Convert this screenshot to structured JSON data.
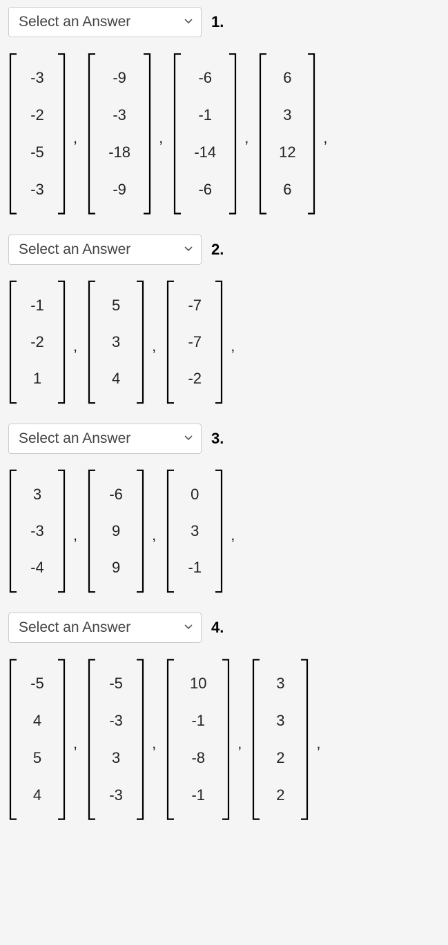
{
  "select_placeholder": "Select an Answer",
  "separator": ",",
  "questions": [
    {
      "label": "1.",
      "size": 4,
      "vectors": [
        {
          "entries": [
            "-3",
            "-2",
            "-5",
            "-3"
          ],
          "wide": false
        },
        {
          "entries": [
            "-9",
            "-3",
            "-18",
            "-9"
          ],
          "wide": true
        },
        {
          "entries": [
            "-6",
            "-1",
            "-14",
            "-6"
          ],
          "wide": true
        },
        {
          "entries": [
            "6",
            "3",
            "12",
            "6"
          ],
          "wide": false
        }
      ],
      "trailing_sep": true
    },
    {
      "label": "2.",
      "size": 3,
      "vectors": [
        {
          "entries": [
            "-1",
            "-2",
            "1"
          ],
          "wide": false
        },
        {
          "entries": [
            "5",
            "3",
            "4"
          ],
          "wide": false
        },
        {
          "entries": [
            "-7",
            "-7",
            "-2"
          ],
          "wide": false
        }
      ],
      "trailing_sep": true
    },
    {
      "label": "3.",
      "size": 3,
      "vectors": [
        {
          "entries": [
            "3",
            "-3",
            "-4"
          ],
          "wide": false
        },
        {
          "entries": [
            "-6",
            "9",
            "9"
          ],
          "wide": false
        },
        {
          "entries": [
            "0",
            "3",
            "-1"
          ],
          "wide": false
        }
      ],
      "trailing_sep": true
    },
    {
      "label": "4.",
      "size": 4,
      "vectors": [
        {
          "entries": [
            "-5",
            "4",
            "5",
            "4"
          ],
          "wide": false
        },
        {
          "entries": [
            "-5",
            "-3",
            "3",
            "-3"
          ],
          "wide": false
        },
        {
          "entries": [
            "10",
            "-1",
            "-8",
            "-1"
          ],
          "wide": true
        },
        {
          "entries": [
            "3",
            "3",
            "2",
            "2"
          ],
          "wide": false
        }
      ],
      "trailing_sep": true
    }
  ]
}
